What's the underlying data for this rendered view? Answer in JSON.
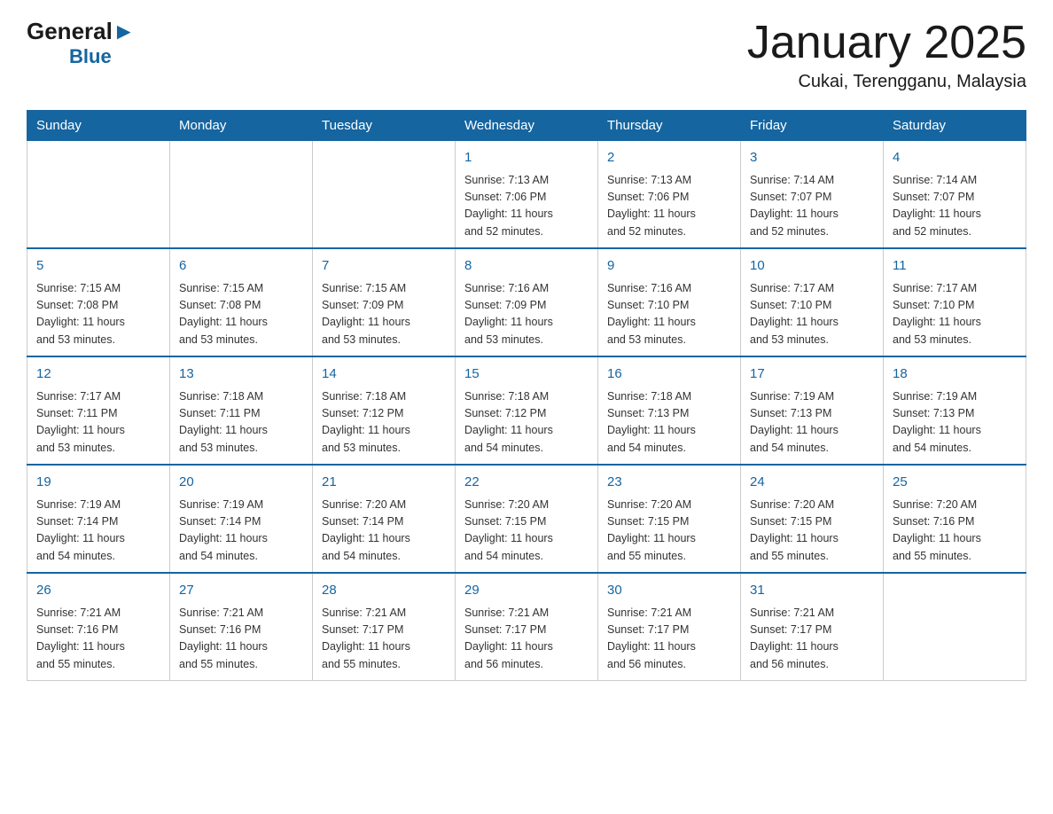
{
  "header": {
    "logo_general": "General",
    "logo_blue": "Blue",
    "month_title": "January 2025",
    "location": "Cukai, Terengganu, Malaysia"
  },
  "days_of_week": [
    "Sunday",
    "Monday",
    "Tuesday",
    "Wednesday",
    "Thursday",
    "Friday",
    "Saturday"
  ],
  "weeks": [
    {
      "days": [
        {
          "number": "",
          "info": ""
        },
        {
          "number": "",
          "info": ""
        },
        {
          "number": "",
          "info": ""
        },
        {
          "number": "1",
          "info": "Sunrise: 7:13 AM\nSunset: 7:06 PM\nDaylight: 11 hours\nand 52 minutes."
        },
        {
          "number": "2",
          "info": "Sunrise: 7:13 AM\nSunset: 7:06 PM\nDaylight: 11 hours\nand 52 minutes."
        },
        {
          "number": "3",
          "info": "Sunrise: 7:14 AM\nSunset: 7:07 PM\nDaylight: 11 hours\nand 52 minutes."
        },
        {
          "number": "4",
          "info": "Sunrise: 7:14 AM\nSunset: 7:07 PM\nDaylight: 11 hours\nand 52 minutes."
        }
      ]
    },
    {
      "days": [
        {
          "number": "5",
          "info": "Sunrise: 7:15 AM\nSunset: 7:08 PM\nDaylight: 11 hours\nand 53 minutes."
        },
        {
          "number": "6",
          "info": "Sunrise: 7:15 AM\nSunset: 7:08 PM\nDaylight: 11 hours\nand 53 minutes."
        },
        {
          "number": "7",
          "info": "Sunrise: 7:15 AM\nSunset: 7:09 PM\nDaylight: 11 hours\nand 53 minutes."
        },
        {
          "number": "8",
          "info": "Sunrise: 7:16 AM\nSunset: 7:09 PM\nDaylight: 11 hours\nand 53 minutes."
        },
        {
          "number": "9",
          "info": "Sunrise: 7:16 AM\nSunset: 7:10 PM\nDaylight: 11 hours\nand 53 minutes."
        },
        {
          "number": "10",
          "info": "Sunrise: 7:17 AM\nSunset: 7:10 PM\nDaylight: 11 hours\nand 53 minutes."
        },
        {
          "number": "11",
          "info": "Sunrise: 7:17 AM\nSunset: 7:10 PM\nDaylight: 11 hours\nand 53 minutes."
        }
      ]
    },
    {
      "days": [
        {
          "number": "12",
          "info": "Sunrise: 7:17 AM\nSunset: 7:11 PM\nDaylight: 11 hours\nand 53 minutes."
        },
        {
          "number": "13",
          "info": "Sunrise: 7:18 AM\nSunset: 7:11 PM\nDaylight: 11 hours\nand 53 minutes."
        },
        {
          "number": "14",
          "info": "Sunrise: 7:18 AM\nSunset: 7:12 PM\nDaylight: 11 hours\nand 53 minutes."
        },
        {
          "number": "15",
          "info": "Sunrise: 7:18 AM\nSunset: 7:12 PM\nDaylight: 11 hours\nand 54 minutes."
        },
        {
          "number": "16",
          "info": "Sunrise: 7:18 AM\nSunset: 7:13 PM\nDaylight: 11 hours\nand 54 minutes."
        },
        {
          "number": "17",
          "info": "Sunrise: 7:19 AM\nSunset: 7:13 PM\nDaylight: 11 hours\nand 54 minutes."
        },
        {
          "number": "18",
          "info": "Sunrise: 7:19 AM\nSunset: 7:13 PM\nDaylight: 11 hours\nand 54 minutes."
        }
      ]
    },
    {
      "days": [
        {
          "number": "19",
          "info": "Sunrise: 7:19 AM\nSunset: 7:14 PM\nDaylight: 11 hours\nand 54 minutes."
        },
        {
          "number": "20",
          "info": "Sunrise: 7:19 AM\nSunset: 7:14 PM\nDaylight: 11 hours\nand 54 minutes."
        },
        {
          "number": "21",
          "info": "Sunrise: 7:20 AM\nSunset: 7:14 PM\nDaylight: 11 hours\nand 54 minutes."
        },
        {
          "number": "22",
          "info": "Sunrise: 7:20 AM\nSunset: 7:15 PM\nDaylight: 11 hours\nand 54 minutes."
        },
        {
          "number": "23",
          "info": "Sunrise: 7:20 AM\nSunset: 7:15 PM\nDaylight: 11 hours\nand 55 minutes."
        },
        {
          "number": "24",
          "info": "Sunrise: 7:20 AM\nSunset: 7:15 PM\nDaylight: 11 hours\nand 55 minutes."
        },
        {
          "number": "25",
          "info": "Sunrise: 7:20 AM\nSunset: 7:16 PM\nDaylight: 11 hours\nand 55 minutes."
        }
      ]
    },
    {
      "days": [
        {
          "number": "26",
          "info": "Sunrise: 7:21 AM\nSunset: 7:16 PM\nDaylight: 11 hours\nand 55 minutes."
        },
        {
          "number": "27",
          "info": "Sunrise: 7:21 AM\nSunset: 7:16 PM\nDaylight: 11 hours\nand 55 minutes."
        },
        {
          "number": "28",
          "info": "Sunrise: 7:21 AM\nSunset: 7:17 PM\nDaylight: 11 hours\nand 55 minutes."
        },
        {
          "number": "29",
          "info": "Sunrise: 7:21 AM\nSunset: 7:17 PM\nDaylight: 11 hours\nand 56 minutes."
        },
        {
          "number": "30",
          "info": "Sunrise: 7:21 AM\nSunset: 7:17 PM\nDaylight: 11 hours\nand 56 minutes."
        },
        {
          "number": "31",
          "info": "Sunrise: 7:21 AM\nSunset: 7:17 PM\nDaylight: 11 hours\nand 56 minutes."
        },
        {
          "number": "",
          "info": ""
        }
      ]
    }
  ]
}
